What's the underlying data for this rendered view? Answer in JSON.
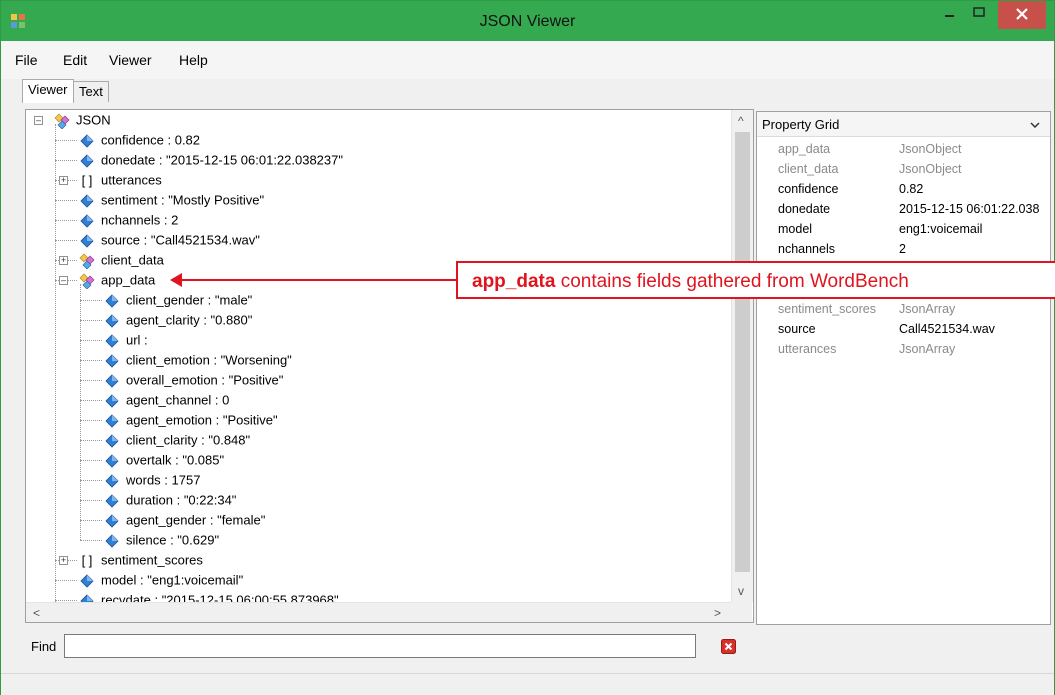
{
  "window": {
    "title": "JSON Viewer"
  },
  "menu": [
    "File",
    "Edit",
    "Viewer",
    "Help"
  ],
  "tabs": [
    {
      "label": "Viewer",
      "active": true
    },
    {
      "label": "Text",
      "active": false
    }
  ],
  "tree": {
    "root": "JSON",
    "rows": [
      {
        "text": "confidence : 0.82",
        "level": 1,
        "kind": "value"
      },
      {
        "text": "donedate : \"2015-12-15 06:01:22.038237\"",
        "level": 1,
        "kind": "value"
      },
      {
        "text": "utterances",
        "level": 1,
        "kind": "array",
        "expander": "+"
      },
      {
        "text": "sentiment : \"Mostly Positive\"",
        "level": 1,
        "kind": "value"
      },
      {
        "text": "nchannels : 2",
        "level": 1,
        "kind": "value"
      },
      {
        "text": "source : \"Call4521534.wav\"",
        "level": 1,
        "kind": "value"
      },
      {
        "text": "client_data",
        "level": 1,
        "kind": "object",
        "expander": "+"
      },
      {
        "text": "app_data",
        "level": 1,
        "kind": "object",
        "expander": "-"
      },
      {
        "text": "client_gender : \"male\"",
        "level": 2,
        "kind": "value"
      },
      {
        "text": "agent_clarity : \"0.880\"",
        "level": 2,
        "kind": "value"
      },
      {
        "text": "url :",
        "level": 2,
        "kind": "value"
      },
      {
        "text": "client_emotion : \"Worsening\"",
        "level": 2,
        "kind": "value"
      },
      {
        "text": "overall_emotion : \"Positive\"",
        "level": 2,
        "kind": "value"
      },
      {
        "text": "agent_channel : 0",
        "level": 2,
        "kind": "value"
      },
      {
        "text": "agent_emotion : \"Positive\"",
        "level": 2,
        "kind": "value"
      },
      {
        "text": "client_clarity : \"0.848\"",
        "level": 2,
        "kind": "value"
      },
      {
        "text": "overtalk : \"0.085\"",
        "level": 2,
        "kind": "value"
      },
      {
        "text": "words : 1757",
        "level": 2,
        "kind": "value"
      },
      {
        "text": "duration : \"0:22:34\"",
        "level": 2,
        "kind": "value"
      },
      {
        "text": "agent_gender : \"female\"",
        "level": 2,
        "kind": "value"
      },
      {
        "text": "silence : \"0.629\"",
        "level": 2,
        "kind": "value"
      },
      {
        "text": "sentiment_scores",
        "level": 1,
        "kind": "array",
        "expander": "+"
      },
      {
        "text": "model : \"eng1:voicemail\"",
        "level": 1,
        "kind": "value"
      },
      {
        "text": "recvdate : \"2015-12-15 06:00:55.873968\"",
        "level": 1,
        "kind": "value"
      }
    ],
    "array_glyph": "[ ]"
  },
  "scroll": {
    "up": "^",
    "down": "v",
    "left": "<",
    "right": ">"
  },
  "property_grid": {
    "title": "Property Grid",
    "rows": [
      {
        "key": "app_data",
        "value": "JsonObject",
        "dim": true
      },
      {
        "key": "client_data",
        "value": "JsonObject",
        "dim": true
      },
      {
        "key": "confidence",
        "value": "0.82",
        "dim": false
      },
      {
        "key": "donedate",
        "value": "2015-12-15 06:01:22.038",
        "dim": false
      },
      {
        "key": "model",
        "value": "eng1:voicemail",
        "dim": false
      },
      {
        "key": "nchannels",
        "value": "2",
        "dim": false
      },
      {
        "key": "",
        "value": "",
        "dim": false
      },
      {
        "key": "",
        "value": "",
        "dim": false
      },
      {
        "key": "sentiment_scores",
        "value": "JsonArray",
        "dim": true
      },
      {
        "key": "source",
        "value": "Call4521534.wav",
        "dim": false
      },
      {
        "key": "utterances",
        "value": "JsonArray",
        "dim": true
      }
    ]
  },
  "find": {
    "label": "Find",
    "value": ""
  },
  "callout": {
    "bold": "app_data",
    "rest": " contains fields gathered from WordBench"
  },
  "colors": {
    "accent": "#e0141e",
    "titlebar": "#35a94f",
    "close": "#c7504a"
  },
  "icons": {
    "value": "blue-diamond-icon",
    "object": "object-node-icon",
    "close": "close-icon",
    "clear_find": "red-x-icon"
  }
}
